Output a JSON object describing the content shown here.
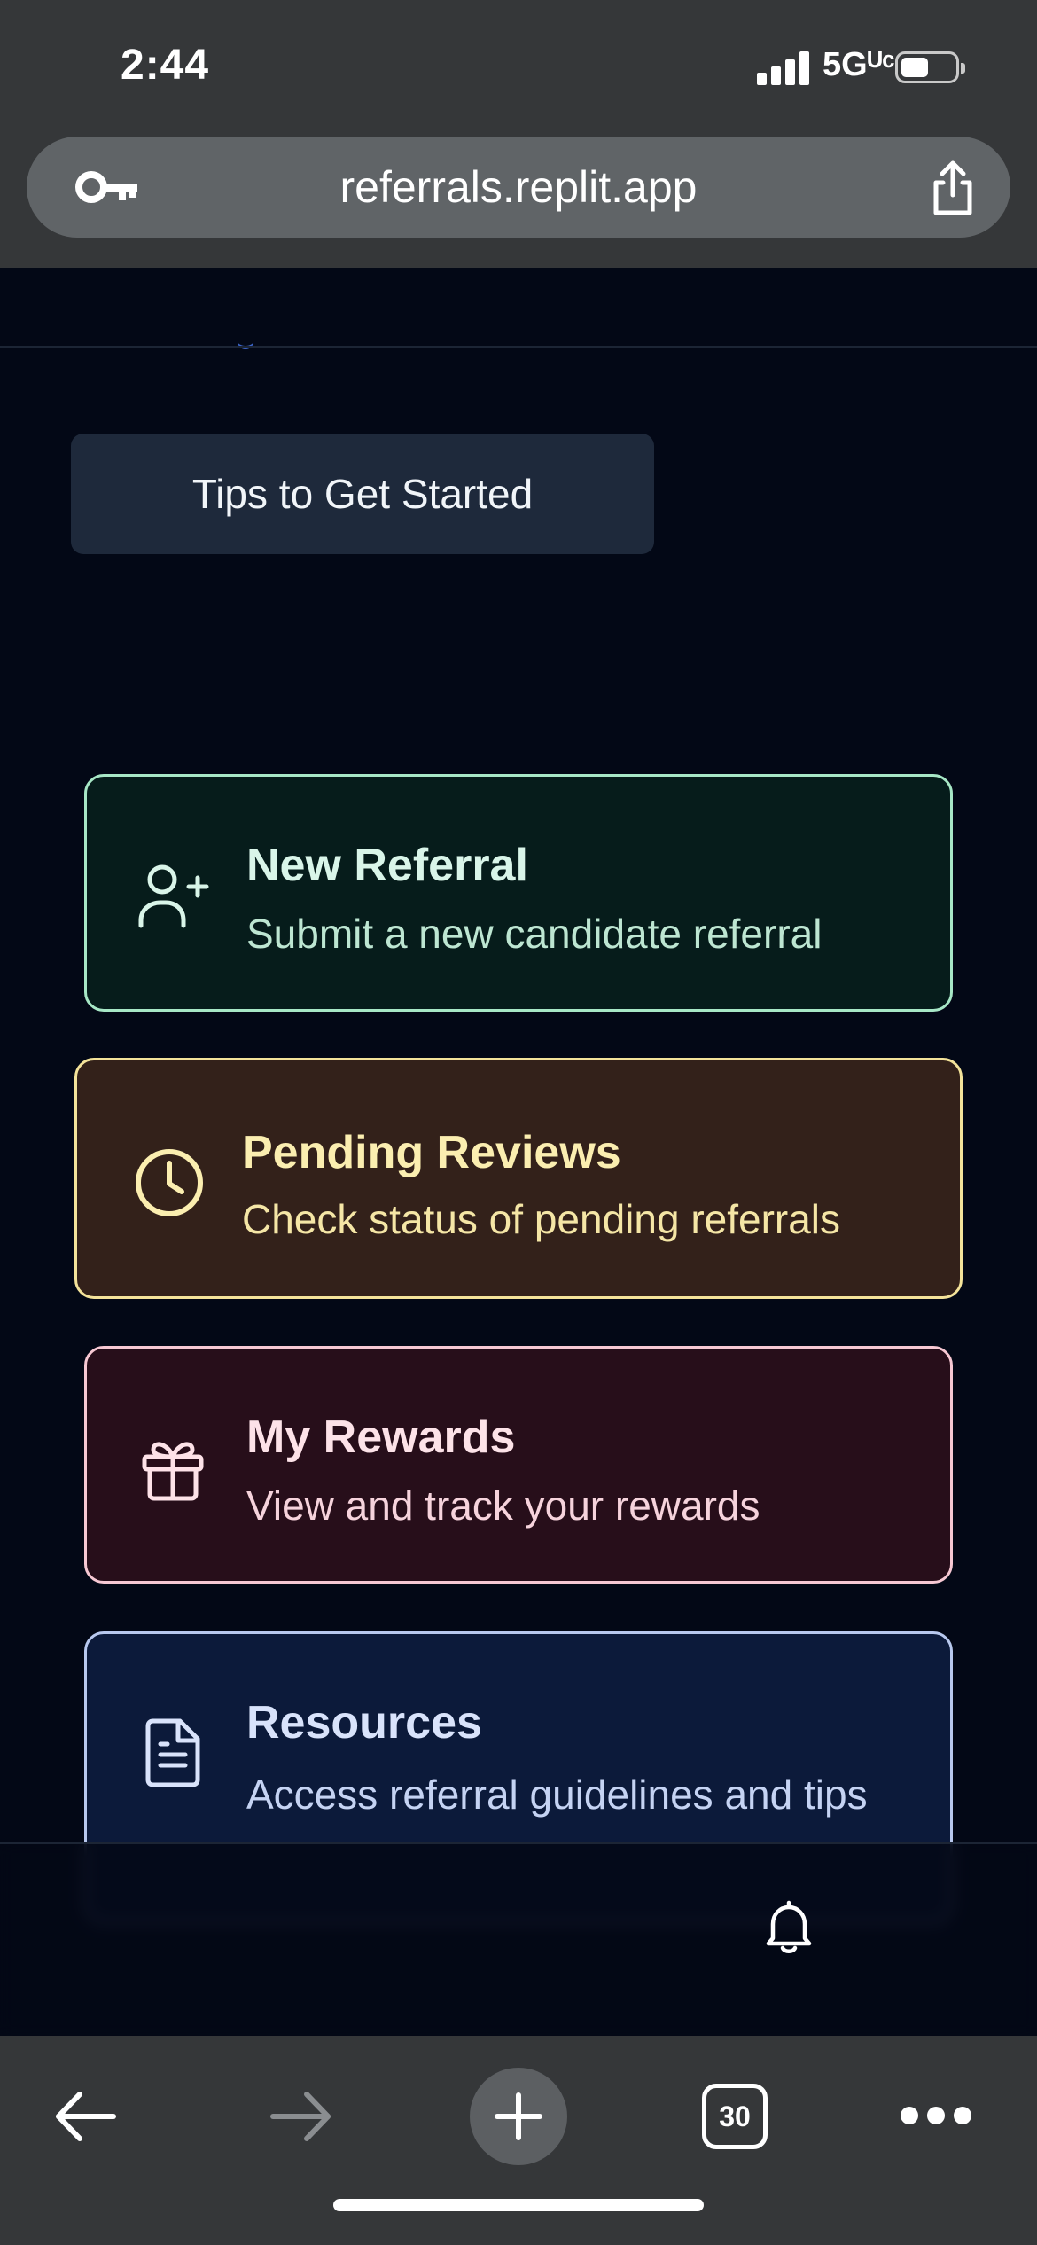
{
  "status_bar": {
    "time": "2:44",
    "network": "5Gᵁᶜ",
    "signal_icon": "cellular-signal-icon",
    "battery_icon": "battery-icon"
  },
  "browser": {
    "url": "referrals.replit.app",
    "key_icon": "key-icon",
    "share_icon": "share-icon",
    "tabs_count": "30"
  },
  "page": {
    "tips_button_label": "Tips to Get Started",
    "cards": [
      {
        "title": "New Referral",
        "subtitle": "Submit a new candidate referral",
        "icon": "user-plus-icon",
        "accent": "#a7e7c6"
      },
      {
        "title": "Pending Reviews",
        "subtitle": "Check status of pending referrals",
        "icon": "clock-icon",
        "accent": "#f4e39a"
      },
      {
        "title": "My Rewards",
        "subtitle": "View and track your rewards",
        "icon": "gift-icon",
        "accent": "#f7c8d3"
      },
      {
        "title": "Resources",
        "subtitle": "Access referral guidelines and tips",
        "icon": "document-icon",
        "accent": "#b8c8ee"
      }
    ],
    "notification_icon": "bell-icon"
  },
  "colors": {
    "page_background": "#030816",
    "browser_chrome": "#353739",
    "tips_button_bg": "#1e293b"
  }
}
